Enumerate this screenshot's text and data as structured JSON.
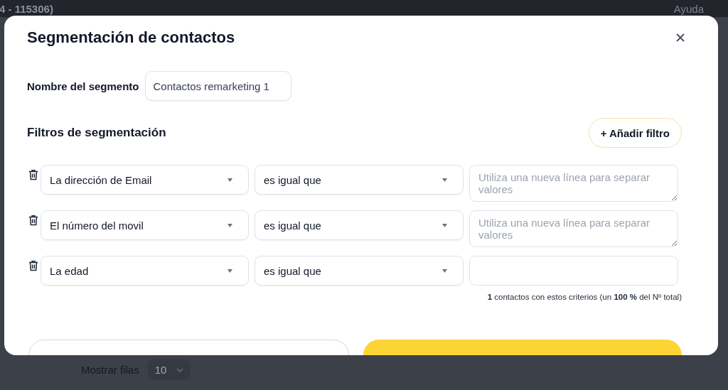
{
  "background": {
    "header_title": "4 - 115306)",
    "help_link": "Ayuda",
    "rows_label": "Mostrar filas",
    "rows_value": "10"
  },
  "modal": {
    "title": "Segmentación de contactos",
    "segment_name": {
      "label": "Nombre del segmento",
      "value": "Contactos remarketing 1"
    },
    "filters_title": "Filtros de segmentación",
    "add_filter_button": "+ Añadir filtro",
    "filters": [
      {
        "kind": "textarea",
        "field": "La dirección de Email",
        "operator": "es igual que",
        "placeholder": "Utiliza una nueva línea para separar valores"
      },
      {
        "kind": "textarea",
        "field": "El número del movil",
        "operator": "es igual que",
        "placeholder": "Utiliza una nueva línea para separar valores"
      },
      {
        "kind": "input",
        "field": "La edad",
        "operator": "es igual que"
      }
    ],
    "summary": "**1** contactos con estos criterios (un **100 %** del Nº total)"
  }
}
